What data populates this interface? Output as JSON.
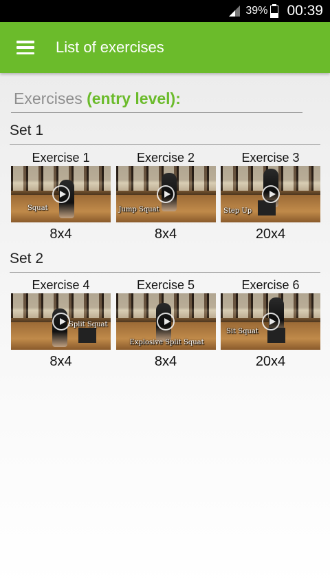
{
  "status_bar": {
    "battery_percent": "39%",
    "time": "00:39",
    "icons": [
      "signal-icon",
      "battery-icon"
    ]
  },
  "app_bar": {
    "title": "List of exercises",
    "menu_icon": "hamburger-menu-icon",
    "color": "#6bbb2b"
  },
  "section": {
    "prefix": "Exercises",
    "level": "(entry level):"
  },
  "sets": [
    {
      "title": "Set 1",
      "exercises": [
        {
          "title": "Exercise 1",
          "video_label": "Squat",
          "reps": "8x4"
        },
        {
          "title": "Exercise 2",
          "video_label": "Jump Squat",
          "reps": "8x4"
        },
        {
          "title": "Exercise 3",
          "video_label": "Step Up",
          "reps": "20x4"
        }
      ]
    },
    {
      "title": "Set 2",
      "exercises": [
        {
          "title": "Exercise 4",
          "video_label": "Split Squat",
          "reps": "8x4"
        },
        {
          "title": "Exercise 5",
          "video_label": "Explosive Split Squat",
          "reps": "8x4"
        },
        {
          "title": "Exercise 6",
          "video_label": "Sit Squat",
          "reps": "20x4"
        }
      ]
    }
  ]
}
